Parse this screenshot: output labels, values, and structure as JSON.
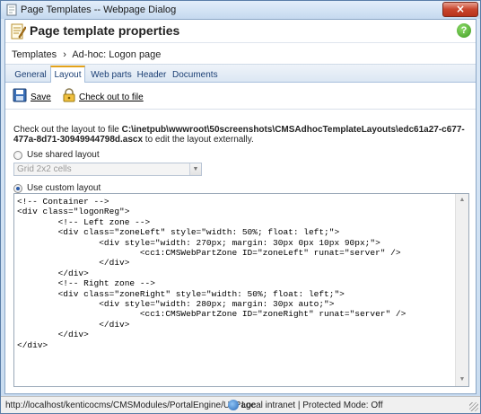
{
  "window": {
    "title": "Page Templates -- Webpage Dialog",
    "close_label": "×"
  },
  "header": {
    "title": "Page template properties",
    "help_label": "?"
  },
  "breadcrumb": {
    "parent": "Templates",
    "separator": "›",
    "current": "Ad-hoc: Logon page"
  },
  "tabs": [
    {
      "label": "General"
    },
    {
      "label": "Layout"
    },
    {
      "label": "Web parts"
    },
    {
      "label": "Header"
    },
    {
      "label": "Documents"
    }
  ],
  "active_tab": "Layout",
  "toolbar": {
    "save_label": "Save",
    "checkout_label": "Check out to file"
  },
  "info": {
    "prefix": "Check out the layout to file ",
    "path": "C:\\inetpub\\wwwroot\\50screenshots\\CMSAdhocTemplateLayouts\\edc61a27-c677-477a-8d71-30949944798d.ascx",
    "suffix": " to edit the layout externally."
  },
  "layout_options": {
    "shared_label": "Use shared layout",
    "shared_selected_value": "Grid 2x2 cells",
    "custom_label": "Use custom layout",
    "selected": "custom"
  },
  "editor": {
    "code": "<!-- Container -->\n<div class=\"logonReg\">\n        <!-- Left zone -->\n        <div class=\"zoneLeft\" style=\"width: 50%; float: left;\">\n                <div style=\"width: 270px; margin: 30px 0px 10px 90px;\">\n                        <cc1:CMSWebPartZone ID=\"zoneLeft\" runat=\"server\" />\n                </div>\n        </div>\n        <!-- Right zone -->\n        <div class=\"zoneRight\" style=\"width: 50%; float: left;\">\n                <div style=\"width: 280px; margin: 30px auto;\">\n                        <cc1:CMSWebPartZone ID=\"zoneRight\" runat=\"server\" />\n                </div>\n        </div>\n</div>"
  },
  "statusbar": {
    "url": "http://localhost/kenticocms/CMSModules/PortalEngine/UI/Page",
    "zone": "Local intranet | Protected Mode: Off"
  },
  "colors": {
    "accent_tab_border": "#e3a21a",
    "close_button": "#c8442c",
    "help_green": "#3d9a21"
  }
}
